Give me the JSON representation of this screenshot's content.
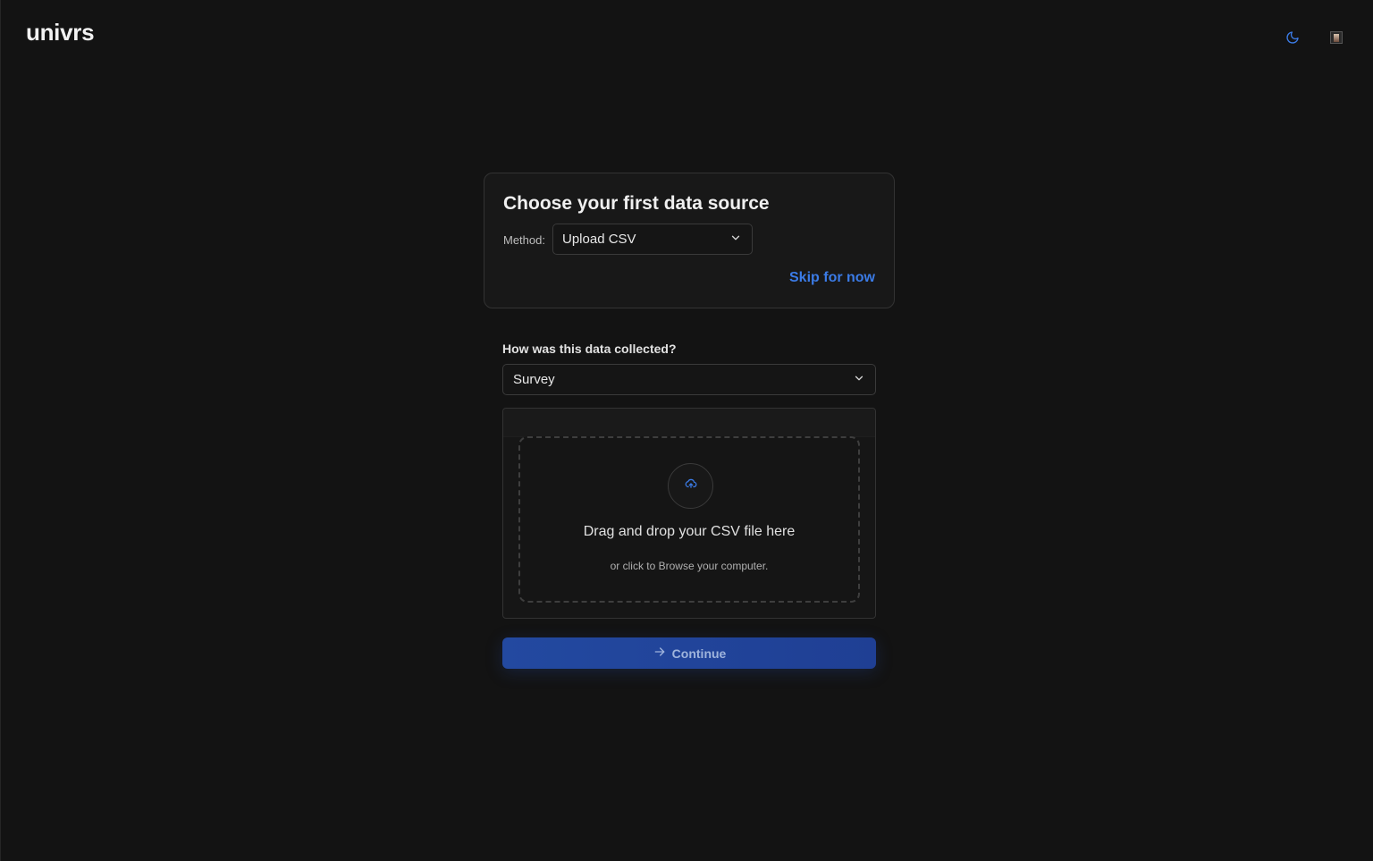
{
  "app": {
    "logo": "univrs"
  },
  "header": {
    "theme_icon": "moon-icon",
    "avatar_icon": "avatar"
  },
  "source_card": {
    "title": "Choose your first data source",
    "method_label": "Method:",
    "method_value": "Upload CSV",
    "skip_label": "Skip for now"
  },
  "collection": {
    "question": "How was this data collected?",
    "value": "Survey"
  },
  "upload": {
    "icon": "cloud-upload-icon",
    "title": "Drag and drop your CSV file here",
    "subtitle": "or click to Browse your computer."
  },
  "continue": {
    "label": "Continue",
    "icon": "arrow-right-icon"
  },
  "colors": {
    "accent": "#3b7be6",
    "background": "#131313",
    "button": "#2349a0"
  }
}
